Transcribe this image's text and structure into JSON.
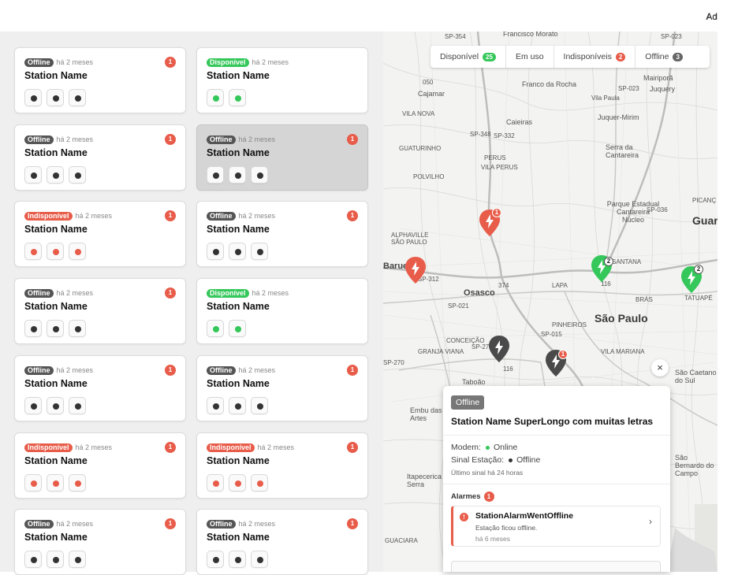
{
  "header": {
    "admin_label": "Ad"
  },
  "filters": [
    {
      "label": "Disponível",
      "count": "25",
      "color": "green"
    },
    {
      "label": "Em uso",
      "count": "",
      "color": ""
    },
    {
      "label": "Indisponíveis",
      "count": "2",
      "color": "red"
    },
    {
      "label": "Offline",
      "count": "3",
      "color": "gray"
    }
  ],
  "cards": [
    {
      "status": "Offline",
      "status_class": "offline",
      "time": "há 2 meses",
      "alarm": "1",
      "name": "Station Name",
      "connectors": [
        "dark",
        "dark",
        "dark"
      ]
    },
    {
      "status": "Disponível",
      "status_class": "disponivel",
      "time": "há 2 meses",
      "alarm": "",
      "name": "Station Name",
      "connectors": [
        "green",
        "green"
      ]
    },
    {
      "status": "Offline",
      "status_class": "offline",
      "time": "há 2 meses",
      "alarm": "1",
      "name": "Station Name",
      "connectors": [
        "dark",
        "dark",
        "dark"
      ]
    },
    {
      "status": "Offline",
      "status_class": "offline",
      "time": "há 2 meses",
      "alarm": "1",
      "name": "Station Name",
      "connectors": [
        "dark",
        "dark",
        "dark"
      ],
      "selected": true
    },
    {
      "status": "Indisponível",
      "status_class": "indisponivel",
      "time": "há 2 meses",
      "alarm": "1",
      "name": "Station Name",
      "connectors": [
        "red",
        "red",
        "red"
      ]
    },
    {
      "status": "Offline",
      "status_class": "offline",
      "time": "há 2 meses",
      "alarm": "1",
      "name": "Station Name",
      "connectors": [
        "dark",
        "dark",
        "dark"
      ]
    },
    {
      "status": "Offline",
      "status_class": "offline",
      "time": "há 2 meses",
      "alarm": "1",
      "name": "Station Name",
      "connectors": [
        "dark",
        "dark",
        "dark"
      ]
    },
    {
      "status": "Disponível",
      "status_class": "disponivel",
      "time": "há 2 meses",
      "alarm": "",
      "name": "Station Name",
      "connectors": [
        "green",
        "green"
      ]
    },
    {
      "status": "Offline",
      "status_class": "offline",
      "time": "há 2 meses",
      "alarm": "1",
      "name": "Station Name",
      "connectors": [
        "dark",
        "dark",
        "dark"
      ]
    },
    {
      "status": "Offline",
      "status_class": "offline",
      "time": "há 2 meses",
      "alarm": "1",
      "name": "Station Name",
      "connectors": [
        "dark",
        "dark",
        "dark"
      ]
    },
    {
      "status": "Indisponível",
      "status_class": "indisponivel",
      "time": "há 2 meses",
      "alarm": "1",
      "name": "Station Name",
      "connectors": [
        "red",
        "red",
        "red"
      ]
    },
    {
      "status": "Indisponível",
      "status_class": "indisponivel",
      "time": "há 2 meses",
      "alarm": "1",
      "name": "Station Name",
      "connectors": [
        "red",
        "red",
        "red"
      ]
    },
    {
      "status": "Offline",
      "status_class": "offline",
      "time": "há 2 meses",
      "alarm": "1",
      "name": "Station Name",
      "connectors": [
        "dark",
        "dark",
        "dark"
      ]
    },
    {
      "status": "Offline",
      "status_class": "offline",
      "time": "há 2 meses",
      "alarm": "1",
      "name": "Station Name",
      "connectors": [
        "dark",
        "dark",
        "dark"
      ]
    }
  ],
  "map_labels": {
    "sp354": "SP-354",
    "francisco_morato": "Francisco Morato",
    "franco_rocha": "Franco da Rocha",
    "cajamar": "Cajamar",
    "caieiras": "Caieiras",
    "mairipora": "Mairiporã",
    "juquery": "Juquery",
    "vila_paula": "Vila Paula",
    "juquer_mirim": "Juquer-Mirim",
    "serra_cantareira": "Serra da Cantareira",
    "vila_nova": "VILA NOVA",
    "guaturinho": "GUATURINHO",
    "polvilho": "POLVILHO",
    "perus": "PERUS",
    "vila_perus": "VILA PERUS",
    "parque_estadual": "Parque Estadual Cantareira Núcleo",
    "alphaville": "ALPHAVILLE SÃO PAULO",
    "barueri": "Barue",
    "osasco": "Osasco",
    "lapa": "LAPA",
    "santana": "SANTANA",
    "bras": "BRÁS",
    "tatuape": "TATUAPÉ",
    "sao_paulo": "São Paulo",
    "pinheiros": "PINHEIROS",
    "vila_mariana": "VILA MARIANA",
    "granja_viana": "GRANJA VIANA",
    "conceicao": "CONCEIÇÃO",
    "taboao": "Taboão",
    "embu": "Embu das Artes",
    "itapecerica": "Itapecerica da Serra",
    "sao_caetano": "São Caetano do Sul",
    "sao_bernardo": "São Bernardo do Campo",
    "guarulhos": "Guar",
    "picanc": "PICANÇ",
    "sp312": "SP-312",
    "sp021": "SP-021",
    "sp270": "SP-270",
    "sp015": "SP-015",
    "sp348": "SP-348",
    "sp332": "SP-332",
    "sp023": "SP-023",
    "sp036": "SP-036",
    "r374": "374",
    "r116": "116",
    "r050": "050",
    "guaciara": "GUACIARA"
  },
  "markers": {
    "m1_count": "1",
    "m2_count": "2",
    "m3_count": "2",
    "m4_count": "1"
  },
  "popup": {
    "status": "Offline",
    "title": "Station Name SuperLongo com muitas letras",
    "modem_label": "Modem:",
    "modem_value": "Online",
    "sinal_label": "Sinal Estação:",
    "sinal_value": "Offline",
    "ultimo_sinal": "Último sinal há 24 horas",
    "alarms_label": "Alarmes",
    "alarms_count": "1",
    "alarm_title": "StationAlarmWentOffline",
    "alarm_desc": "Estação ficou offline.",
    "alarm_time": "há 6 meses",
    "close_symbol": "×"
  },
  "colors": {
    "green": "#34c759",
    "red": "#e85c4a",
    "offline": "#555555",
    "accent": "#f1c232"
  }
}
